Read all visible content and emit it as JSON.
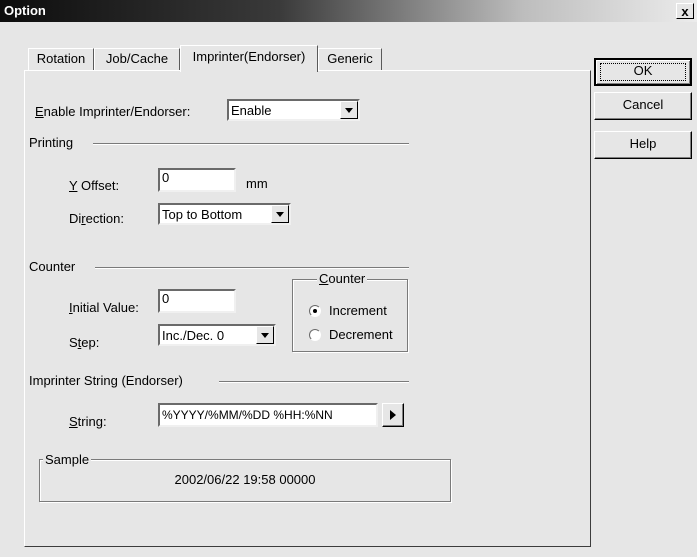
{
  "window": {
    "title": "Option",
    "close_label": "x"
  },
  "tabs": [
    {
      "label": "Rotation",
      "active": false
    },
    {
      "label": "Job/Cache",
      "active": false
    },
    {
      "label": "Imprinter(Endorser)",
      "active": true
    },
    {
      "label": "Generic",
      "active": false
    }
  ],
  "enable": {
    "label_mnemonic": "E",
    "label_rest": "nable Imprinter/Endorser:",
    "value": "Enable"
  },
  "printing": {
    "section_title": "Printing",
    "y_offset": {
      "label_mnemonic": "Y",
      "label_rest": " Offset:",
      "value": "0",
      "unit": "mm"
    },
    "direction": {
      "label_pre": "Di",
      "label_mnemonic": "r",
      "label_rest": "ection:",
      "value": "Top to Bottom"
    }
  },
  "counter": {
    "section_title": "Counter",
    "initial_value": {
      "label_mnemonic": "I",
      "label_rest": "nitial Value:",
      "value": "0"
    },
    "step": {
      "label_pre": "S",
      "label_mnemonic": "t",
      "label_rest": "ep:",
      "value": "Inc./Dec. 0"
    },
    "group": {
      "title_mnemonic": "C",
      "title_rest": "ounter",
      "options": [
        {
          "label": "Increment",
          "selected": true
        },
        {
          "label": "Decrement",
          "selected": false
        }
      ]
    }
  },
  "imprinter_string": {
    "section_title": "Imprinter String (Endorser)",
    "label_mnemonic": "S",
    "label_rest": "tring:",
    "value": "%YYYY/%MM/%DD %HH:%NN"
  },
  "sample": {
    "title": "Sample",
    "value": "2002/06/22 19:58 00000"
  },
  "buttons": {
    "ok": "OK",
    "cancel": "Cancel",
    "help": "Help"
  }
}
